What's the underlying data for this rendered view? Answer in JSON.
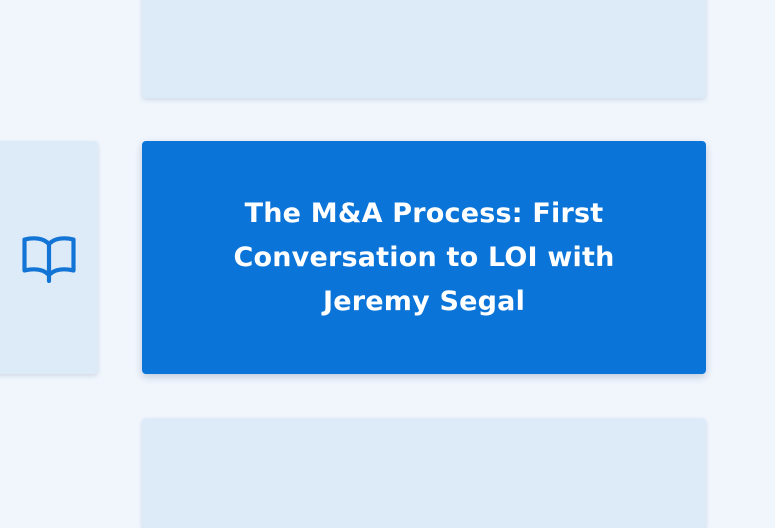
{
  "featured_card": {
    "title": "The M&A Process: First Conversation to LOI with Jeremy Segal"
  },
  "side_card": {
    "icon": "book-icon"
  },
  "colors": {
    "background": "#f1f6fd",
    "card_light": "#ddebf9",
    "card_active": "#0b74d8",
    "icon": "#1275d6",
    "title_text": "#ffffff"
  }
}
